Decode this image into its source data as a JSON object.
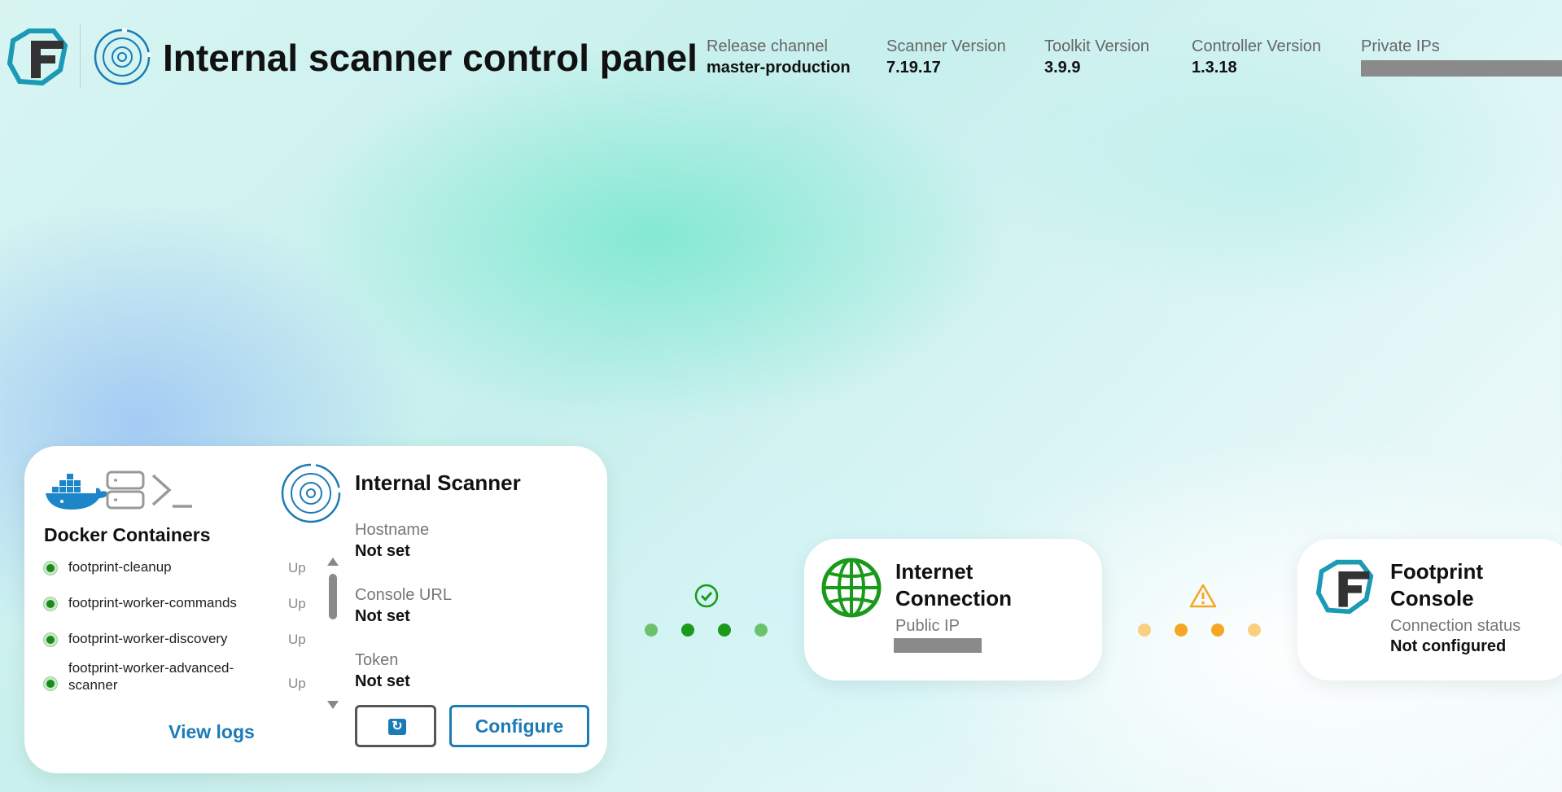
{
  "header": {
    "title": "Internal scanner control panel",
    "meta": [
      {
        "label": "Release channel",
        "value": "master-production"
      },
      {
        "label": "Scanner Version",
        "value": "7.19.17"
      },
      {
        "label": "Toolkit Version",
        "value": "3.9.9"
      },
      {
        "label": "Controller Version",
        "value": "1.3.18"
      },
      {
        "label": "Private IPs",
        "value": ""
      }
    ]
  },
  "docker": {
    "title": "Docker Containers",
    "containers": [
      {
        "name": "footprint-cleanup",
        "status": "Up"
      },
      {
        "name": "footprint-worker-commands",
        "status": "Up"
      },
      {
        "name": "footprint-worker-discovery",
        "status": "Up"
      },
      {
        "name": "footprint-worker-advanced-scanner",
        "status": "Up"
      }
    ],
    "view_logs_label": "View logs"
  },
  "scanner": {
    "title": "Internal Scanner",
    "fields": [
      {
        "label": "Hostname",
        "value": "Not set"
      },
      {
        "label": "Console URL",
        "value": "Not set"
      },
      {
        "label": "Token",
        "value": "Not set"
      }
    ],
    "configure_label": "Configure"
  },
  "internet": {
    "title": "Internet Connection",
    "public_ip_label": "Public IP"
  },
  "console": {
    "title": "Footprint Console",
    "status_label": "Connection status",
    "status_value": "Not configured"
  },
  "colors": {
    "accent": "#1b7bb5",
    "ok": "#1a9a1a",
    "warn": "#f5a623",
    "brand_teal": "#1a9ab5",
    "brand_dark": "#333333"
  },
  "icons": {
    "brand_logo": "footprint-logo",
    "scanner": "scanner-target-icon",
    "docker": "docker-whale-icon",
    "server": "server-icon",
    "terminal": "terminal-icon",
    "globe": "globe-icon",
    "check": "check-circle-icon",
    "warning": "warning-triangle-icon",
    "refresh": "refresh-icon"
  }
}
